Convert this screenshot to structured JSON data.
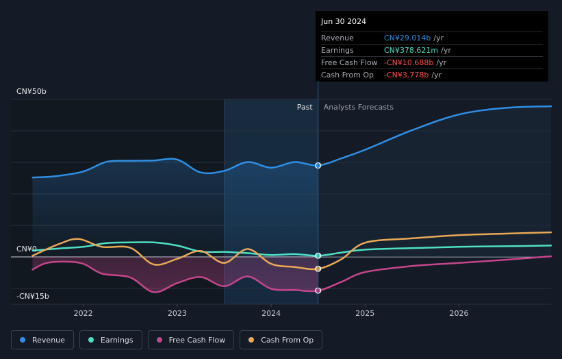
{
  "chart_data": {
    "type": "line",
    "y_axis_labels": [
      {
        "text": "CN¥50b",
        "value": 50
      },
      {
        "text": "CN¥0",
        "value": 0
      },
      {
        "text": "-CN¥15b",
        "value": -15
      }
    ],
    "ylim": [
      -15,
      50
    ],
    "x_ticks": [
      {
        "label": "2022",
        "value": 2022
      },
      {
        "label": "2023",
        "value": 2023
      },
      {
        "label": "2024",
        "value": 2024
      },
      {
        "label": "2025",
        "value": 2025
      },
      {
        "label": "2026",
        "value": 2026
      }
    ],
    "xlim": [
      2021.23,
      2026.98
    ],
    "past_label": "Past",
    "forecast_label": "Analysts Forecasts",
    "divider_x": 2024.5,
    "highlight_start": 2023.5,
    "series": [
      {
        "name": "Revenue",
        "color": "#2f8fe6",
        "points": [
          [
            2021.46,
            25.2
          ],
          [
            2021.7,
            25.6
          ],
          [
            2022.0,
            27.1
          ],
          [
            2022.25,
            30.2
          ],
          [
            2022.5,
            30.5
          ],
          [
            2022.75,
            30.6
          ],
          [
            2023.0,
            30.9
          ],
          [
            2023.25,
            26.8
          ],
          [
            2023.5,
            27.3
          ],
          [
            2023.75,
            30.1
          ],
          [
            2024.0,
            28.3
          ],
          [
            2024.25,
            30.1
          ],
          [
            2024.5,
            29.014
          ],
          [
            2024.75,
            31.3
          ],
          [
            2025.0,
            34.0
          ],
          [
            2025.5,
            40.2
          ],
          [
            2026.0,
            45.2
          ],
          [
            2026.5,
            47.3
          ],
          [
            2026.98,
            47.8
          ]
        ],
        "forecast_from": 2024.5
      },
      {
        "name": "Earnings",
        "color": "#4fe0c4",
        "points": [
          [
            2021.46,
            2.0
          ],
          [
            2021.75,
            2.7
          ],
          [
            2022.0,
            3.2
          ],
          [
            2022.25,
            4.4
          ],
          [
            2022.5,
            4.6
          ],
          [
            2022.75,
            4.6
          ],
          [
            2023.0,
            3.6
          ],
          [
            2023.25,
            1.7
          ],
          [
            2023.5,
            1.6
          ],
          [
            2023.75,
            1.2
          ],
          [
            2024.0,
            0.6
          ],
          [
            2024.25,
            0.9
          ],
          [
            2024.5,
            0.379
          ],
          [
            2024.75,
            1.4
          ],
          [
            2025.0,
            2.3
          ],
          [
            2025.5,
            2.8
          ],
          [
            2026.0,
            3.2
          ],
          [
            2026.5,
            3.4
          ],
          [
            2026.98,
            3.6
          ]
        ],
        "forecast_from": 2024.5
      },
      {
        "name": "Free Cash Flow",
        "color": "#c4468c",
        "points": [
          [
            2021.46,
            -4.0
          ],
          [
            2021.6,
            -2.0
          ],
          [
            2021.8,
            -1.5
          ],
          [
            2022.0,
            -2.2
          ],
          [
            2022.2,
            -5.3
          ],
          [
            2022.5,
            -6.5
          ],
          [
            2022.75,
            -11.2
          ],
          [
            2023.0,
            -8.3
          ],
          [
            2023.25,
            -6.4
          ],
          [
            2023.5,
            -9.3
          ],
          [
            2023.75,
            -6.2
          ],
          [
            2024.0,
            -10.1
          ],
          [
            2024.25,
            -10.5
          ],
          [
            2024.5,
            -10.688
          ],
          [
            2024.75,
            -7.9
          ],
          [
            2025.0,
            -4.8
          ],
          [
            2025.5,
            -2.9
          ],
          [
            2026.0,
            -1.9
          ],
          [
            2026.5,
            -0.9
          ],
          [
            2026.98,
            0.2
          ]
        ],
        "forecast_from": 2024.5
      },
      {
        "name": "Cash From Op",
        "color": "#e9a957",
        "points": [
          [
            2021.46,
            0.4
          ],
          [
            2021.75,
            4.2
          ],
          [
            2021.95,
            5.7
          ],
          [
            2022.2,
            3.2
          ],
          [
            2022.5,
            2.9
          ],
          [
            2022.75,
            -2.4
          ],
          [
            2023.0,
            -0.6
          ],
          [
            2023.25,
            1.9
          ],
          [
            2023.5,
            -1.9
          ],
          [
            2023.75,
            2.5
          ],
          [
            2024.0,
            -2.2
          ],
          [
            2024.25,
            -3.2
          ],
          [
            2024.5,
            -3.778
          ],
          [
            2024.75,
            -0.7
          ],
          [
            2025.0,
            4.5
          ],
          [
            2025.5,
            5.9
          ],
          [
            2026.0,
            6.9
          ],
          [
            2026.5,
            7.4
          ],
          [
            2026.98,
            7.8
          ]
        ],
        "forecast_from": 2024.5
      }
    ]
  },
  "tooltip": {
    "date": "Jun 30 2024",
    "rows": [
      {
        "label": "Revenue",
        "value": "CN¥29.014b",
        "unit": "/yr",
        "color": "#2f8fe6"
      },
      {
        "label": "Earnings",
        "value": "CN¥378.621m",
        "unit": "/yr",
        "color": "#4fe0c4"
      },
      {
        "label": "Free Cash Flow",
        "value": "-CN¥10.688b",
        "unit": "/yr",
        "color": "#ff4d4d"
      },
      {
        "label": "Cash From Op",
        "value": "-CN¥3.778b",
        "unit": "/yr",
        "color": "#ff4d4d"
      }
    ]
  },
  "legend": [
    {
      "label": "Revenue",
      "color": "#2f8fe6"
    },
    {
      "label": "Earnings",
      "color": "#4fe0c4"
    },
    {
      "label": "Free Cash Flow",
      "color": "#c4468c"
    },
    {
      "label": "Cash From Op",
      "color": "#e9a957"
    }
  ]
}
